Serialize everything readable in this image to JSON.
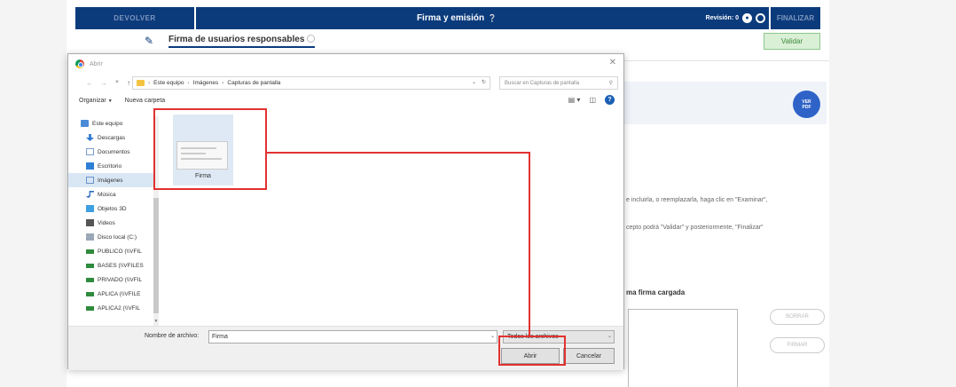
{
  "app": {
    "devolver": "DEVOLVER",
    "title": "Firma y emisión",
    "revision_label": "Revisión: 0",
    "finalizar": "FINALIZAR",
    "tab_title": "Firma de usuarios responsables",
    "validar": "Validar",
    "ver_pdf_line1": "VER",
    "ver_pdf_line2": "PDF",
    "text1": "e incluirla, o reemplazarla, haga clic en \"Examinar\",",
    "text2": "cepto podrá \"Validar\" y posteriormente, \"Finalizar\"",
    "firma_cargada": "ma firma cargada",
    "pill1": "BORRAR",
    "pill2": "FIRMAR"
  },
  "dialog": {
    "title": "Abrir",
    "breadcrumb": [
      "Este equipo",
      "Imágenes",
      "Capturas de pantalla"
    ],
    "search_placeholder": "Buscar en Capturas de pantalla",
    "organize": "Organizar",
    "new_folder": "Nueva carpeta",
    "sidebar": [
      {
        "label": "Este equipo",
        "icon": "computer-icon"
      },
      {
        "label": "Descargas",
        "icon": "download-icon"
      },
      {
        "label": "Documentos",
        "icon": "document-icon"
      },
      {
        "label": "Escritorio",
        "icon": "desktop-icon"
      },
      {
        "label": "Imágenes",
        "icon": "images-icon"
      },
      {
        "label": "Música",
        "icon": "music-icon"
      },
      {
        "label": "Objetos 3D",
        "icon": "3d-objects-icon"
      },
      {
        "label": "Videos",
        "icon": "video-icon"
      },
      {
        "label": "Disco local (C:)",
        "icon": "disk-icon"
      },
      {
        "label": "PUBLICO (\\\\VFIL",
        "icon": "network-drive-icon"
      },
      {
        "label": "BASES (\\\\VFILES",
        "icon": "network-drive-icon"
      },
      {
        "label": "PRIVADO (\\\\VFIL",
        "icon": "network-drive-icon"
      },
      {
        "label": "APLICA (\\\\VFILE",
        "icon": "network-drive-icon"
      },
      {
        "label": "APLICA2 (\\\\VFIL",
        "icon": "network-drive-icon"
      }
    ],
    "file_name": "Firma",
    "filename_label": "Nombre de archivo:",
    "filename_value": "Firma",
    "filetype": "Todos los archivos",
    "open": "Abrir",
    "cancel": "Cancelar"
  },
  "colors": {
    "accent": "#0c3b7c",
    "annotation": "#e23131",
    "validar_bg": "#d9f0d6"
  }
}
